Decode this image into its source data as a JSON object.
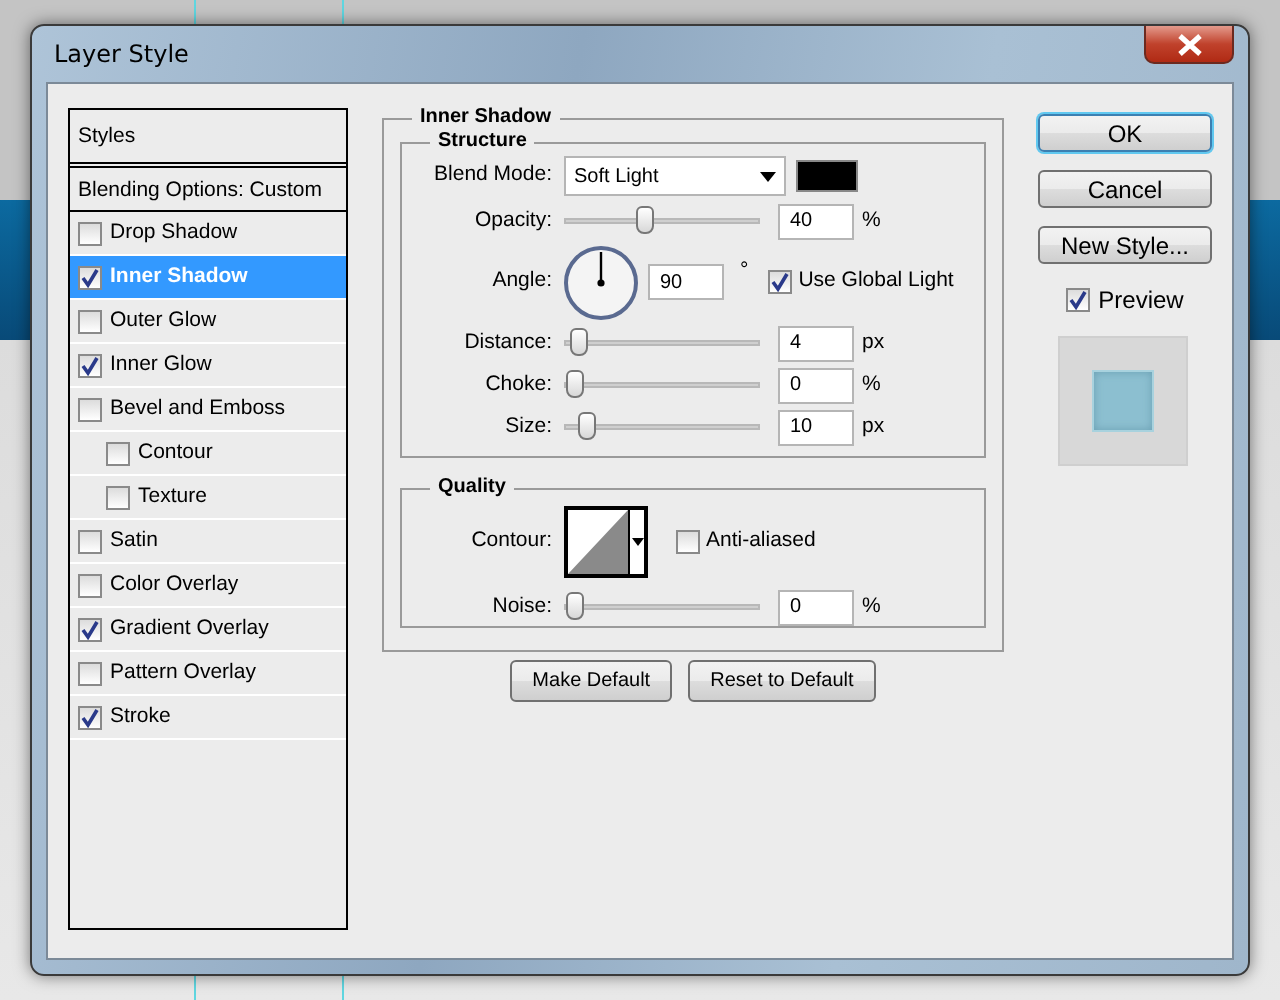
{
  "window": {
    "title": "Layer Style"
  },
  "styles_list": {
    "header": "Styles",
    "blending_options": "Blending Options: Custom",
    "items": [
      {
        "label": "Drop Shadow",
        "checked": false,
        "selected": false
      },
      {
        "label": "Inner Shadow",
        "checked": true,
        "selected": true
      },
      {
        "label": "Outer Glow",
        "checked": false,
        "selected": false
      },
      {
        "label": "Inner Glow",
        "checked": true,
        "selected": false
      },
      {
        "label": "Bevel and Emboss",
        "checked": false,
        "selected": false,
        "children": [
          {
            "label": "Contour",
            "checked": false,
            "selected": false
          },
          {
            "label": "Texture",
            "checked": false,
            "selected": false
          }
        ]
      },
      {
        "label": "Satin",
        "checked": false,
        "selected": false
      },
      {
        "label": "Color Overlay",
        "checked": false,
        "selected": false
      },
      {
        "label": "Gradient Overlay",
        "checked": true,
        "selected": false
      },
      {
        "label": "Pattern Overlay",
        "checked": false,
        "selected": false
      },
      {
        "label": "Stroke",
        "checked": true,
        "selected": false
      }
    ]
  },
  "panel": {
    "title": "Inner Shadow",
    "structure": {
      "title": "Structure",
      "rows": [
        {
          "kind": "select",
          "label": "Blend Mode:",
          "value": "Soft Light",
          "color": "#000000"
        },
        {
          "kind": "slider",
          "label": "Opacity:",
          "level": 0.4,
          "value": "40",
          "unit": "%"
        },
        {
          "kind": "angle",
          "label": "Angle:",
          "value": "90",
          "unit": "°",
          "option": {
            "label": "Use Global Light",
            "checked": true
          }
        },
        {
          "kind": "slider",
          "label": "Distance:",
          "level": 0.02,
          "value": "4",
          "unit": "px"
        },
        {
          "kind": "slider",
          "label": "Choke:",
          "level": 0,
          "value": "0",
          "unit": "%"
        },
        {
          "kind": "slider",
          "label": "Size:",
          "level": 0.07,
          "value": "10",
          "unit": "px"
        }
      ]
    },
    "quality": {
      "title": "Quality",
      "rows": [
        {
          "kind": "contour",
          "label": "Contour:",
          "option": {
            "label": "Anti-aliased",
            "checked": false
          }
        },
        {
          "kind": "slider",
          "label": "Noise:",
          "level": 0,
          "value": "0",
          "unit": "%"
        }
      ]
    },
    "buttons": [
      "Make Default",
      "Reset to Default"
    ]
  },
  "actions": [
    {
      "label": "OK",
      "default": true
    },
    {
      "label": "Cancel",
      "default": false
    },
    {
      "label": "New Style...",
      "default": false
    }
  ],
  "preview": {
    "label": "Preview",
    "checked": true
  }
}
